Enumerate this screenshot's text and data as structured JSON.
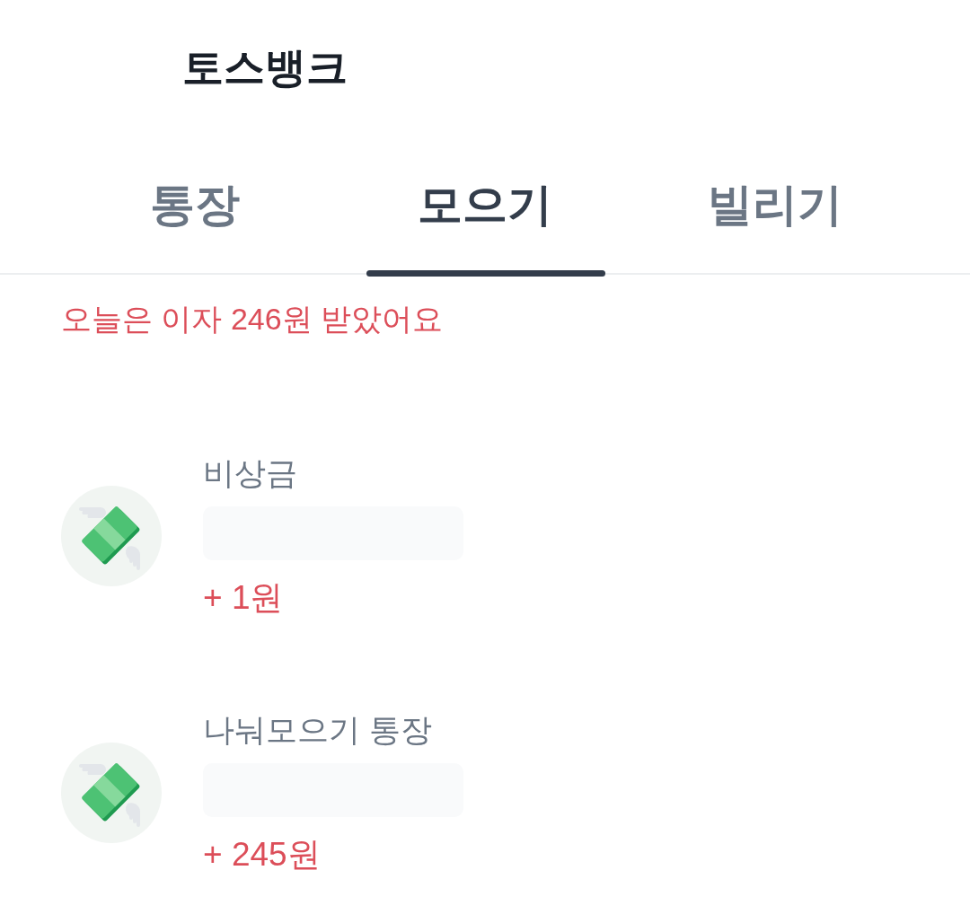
{
  "header": {
    "title": "토스뱅크"
  },
  "tabs": [
    {
      "label": "통장",
      "selected": false
    },
    {
      "label": "모으기",
      "selected": true
    },
    {
      "label": "빌리기",
      "selected": false
    }
  ],
  "interest_notice": "오늘은 이자 246원 받았어요",
  "accounts": [
    {
      "name": "비상금",
      "balance_masked": true,
      "interest": "+ 1원"
    },
    {
      "name": "나눠모으기 통장",
      "balance_masked": true,
      "interest": "+ 245원"
    }
  ]
}
